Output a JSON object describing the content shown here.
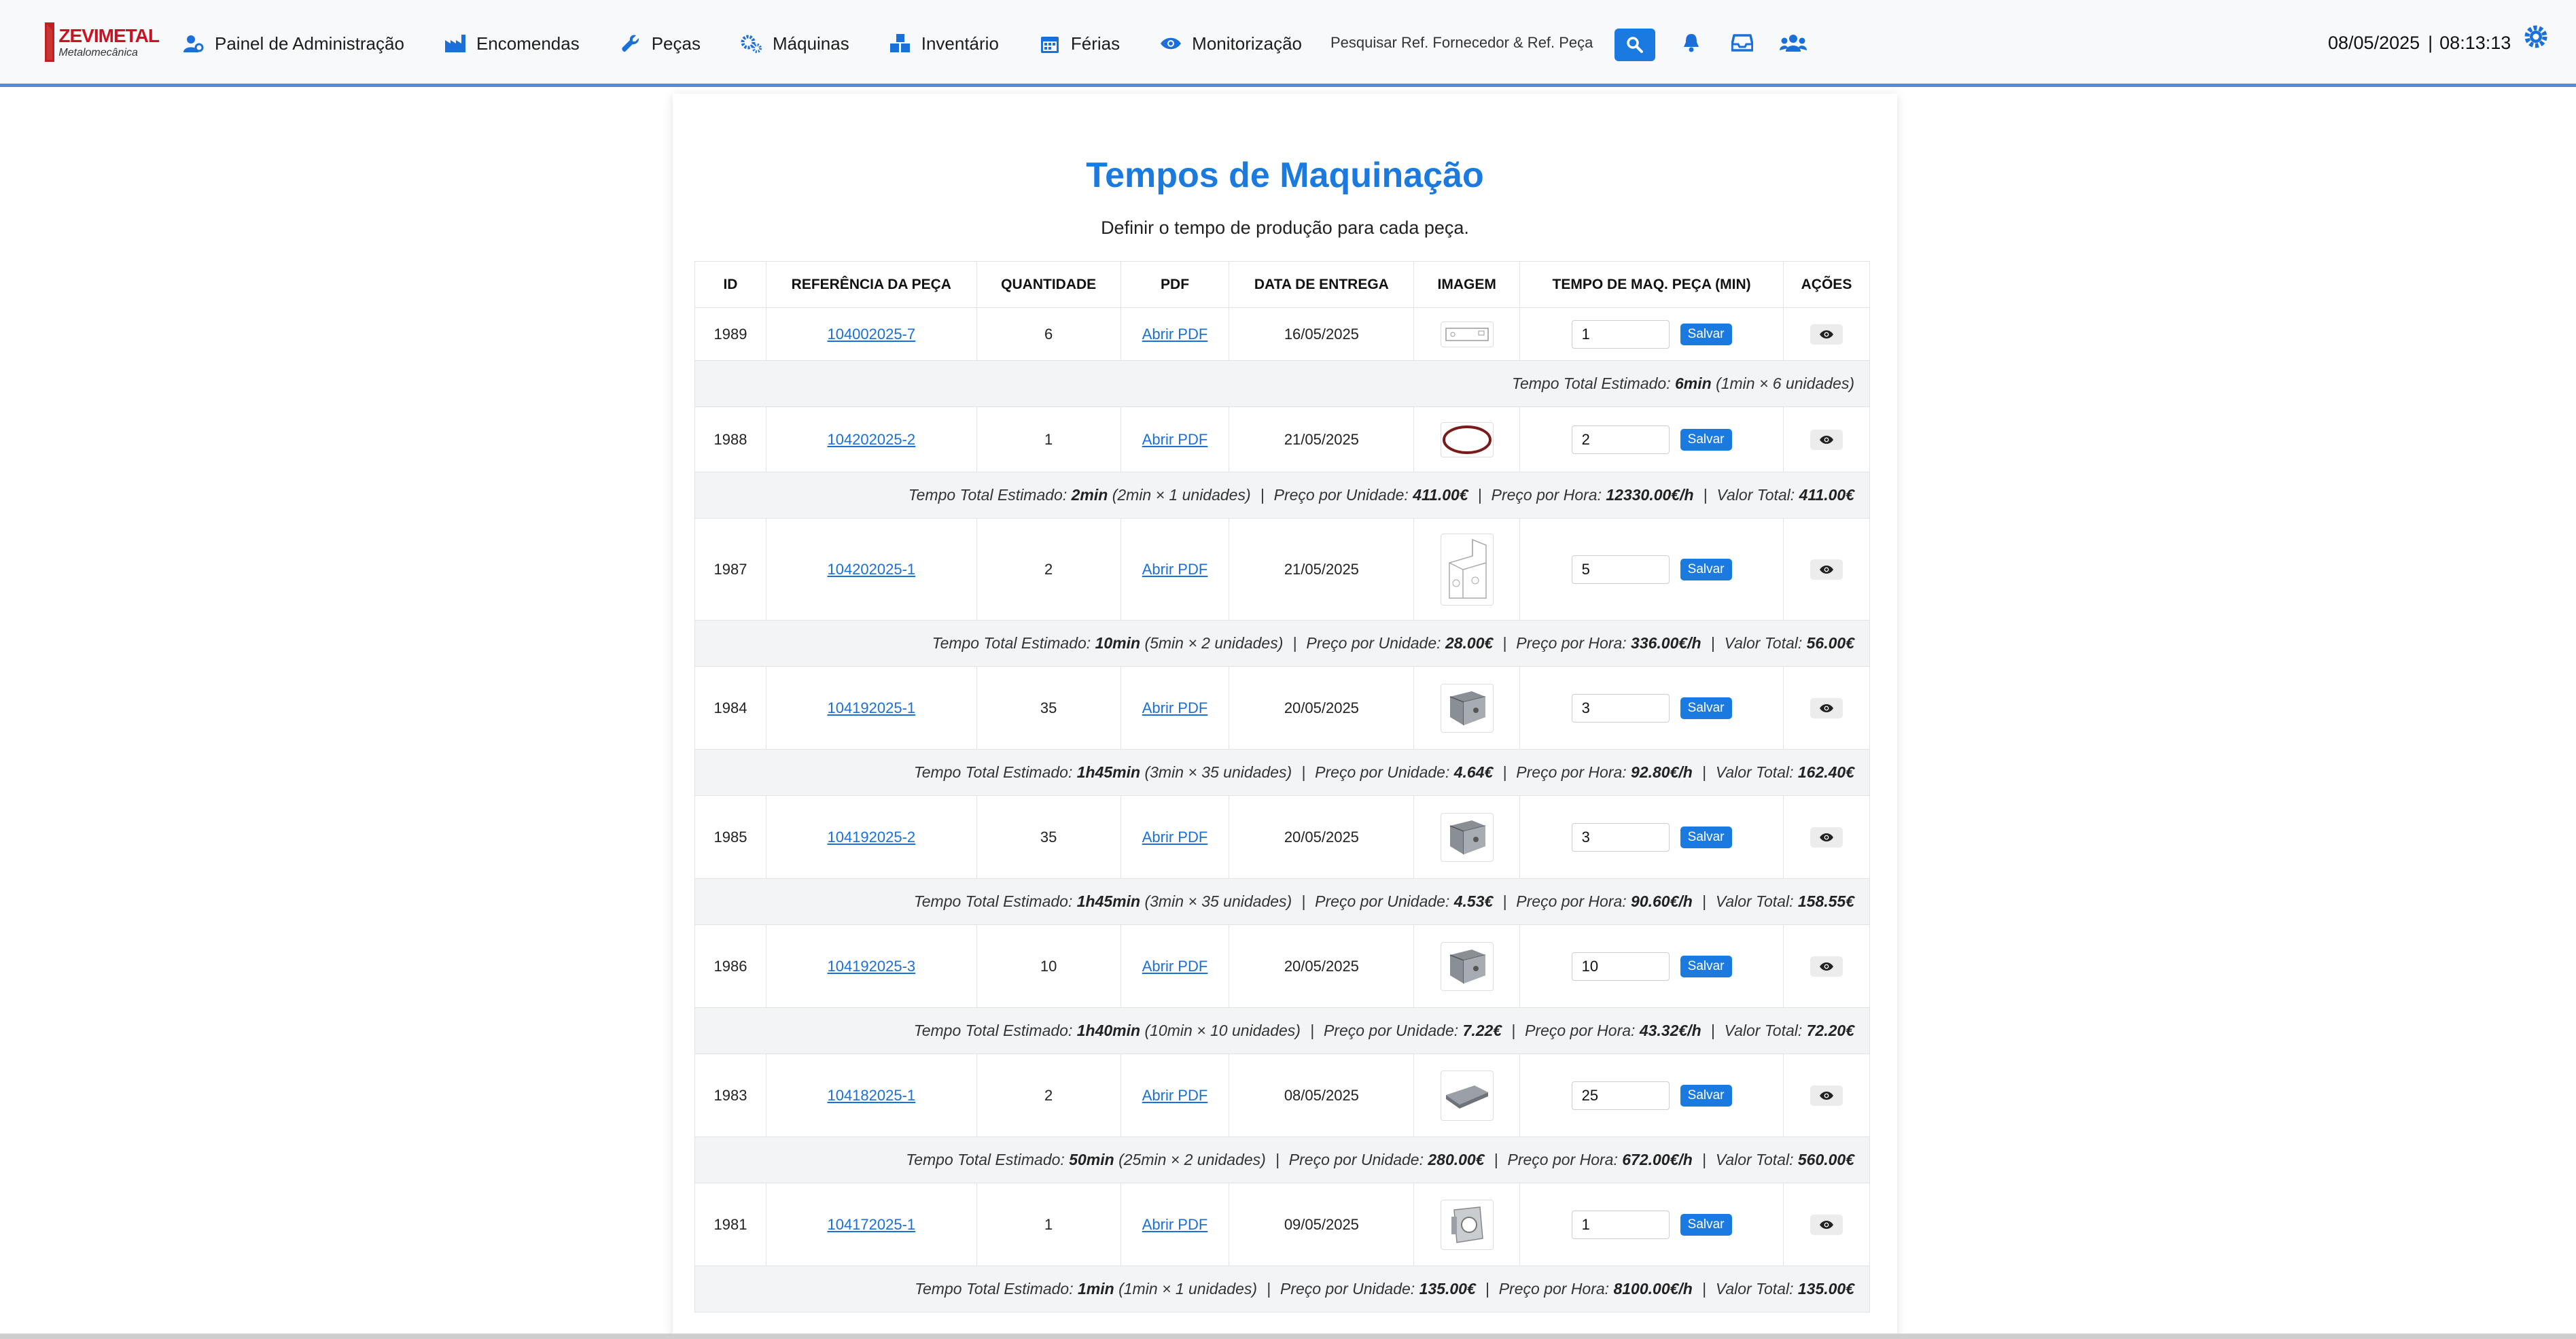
{
  "brand": {
    "name": "ZEVIMETAL",
    "tagline": "Metalomecânica"
  },
  "nav": [
    {
      "label": "Painel de Administração",
      "icon": "user-gear-icon"
    },
    {
      "label": "Encomendas",
      "icon": "industry-icon"
    },
    {
      "label": "Peças",
      "icon": "wrench-icon"
    },
    {
      "label": "Máquinas",
      "icon": "gears-icon"
    },
    {
      "label": "Inventário",
      "icon": "boxes-icon"
    },
    {
      "label": "Férias",
      "icon": "calendar-icon"
    },
    {
      "label": "Monitorização",
      "icon": "eye-icon"
    }
  ],
  "search": {
    "placeholder": "Pesquisar Ref. Fornecedor & Ref. Peça"
  },
  "datetime": {
    "date": "08/05/2025",
    "separator": "|",
    "time": "08:13:13"
  },
  "page": {
    "title": "Tempos de Maquinação",
    "subtitle": "Definir o tempo de produção para cada peça."
  },
  "table": {
    "headers": [
      "ID",
      "REFERÊNCIA DA PEÇA",
      "QUANTIDADE",
      "PDF",
      "DATA DE ENTREGA",
      "IMAGEM",
      "TEMPO DE MAQ. PEÇA (MIN)",
      "AÇÕES"
    ],
    "pdf_label": "Abrir PDF",
    "save_label": "Salvar",
    "summary_labels": {
      "total": "Tempo Total Estimado:",
      "unit_price": "Preço por Unidade:",
      "hour_price": "Preço por Hora:",
      "total_value": "Valor Total:"
    },
    "rows": [
      {
        "id": "1989",
        "ref": "104002025-7",
        "qty": "6",
        "date": "16/05/2025",
        "time": "1",
        "image": "flat-plate",
        "summary": {
          "total": "6min",
          "detail": "(1min × 6 unidades)",
          "unit_price": "",
          "hour_price": "",
          "total_value": ""
        }
      },
      {
        "id": "1988",
        "ref": "104202025-2",
        "qty": "1",
        "date": "21/05/2025",
        "time": "2",
        "image": "ring",
        "summary": {
          "total": "2min",
          "detail": "(2min × 1 unidades)",
          "unit_price": "411.00€",
          "hour_price": "12330.00€/h",
          "total_value": "411.00€"
        }
      },
      {
        "id": "1987",
        "ref": "104202025-1",
        "qty": "2",
        "date": "21/05/2025",
        "time": "5",
        "image": "bracket",
        "summary": {
          "total": "10min",
          "detail": "(5min × 2 unidades)",
          "unit_price": "28.00€",
          "hour_price": "336.00€/h",
          "total_value": "56.00€"
        }
      },
      {
        "id": "1984",
        "ref": "104192025-1",
        "qty": "35",
        "date": "20/05/2025",
        "time": "3",
        "image": "block",
        "summary": {
          "total": "1h45min",
          "detail": "(3min × 35 unidades)",
          "unit_price": "4.64€",
          "hour_price": "92.80€/h",
          "total_value": "162.40€"
        }
      },
      {
        "id": "1985",
        "ref": "104192025-2",
        "qty": "35",
        "date": "20/05/2025",
        "time": "3",
        "image": "block",
        "summary": {
          "total": "1h45min",
          "detail": "(3min × 35 unidades)",
          "unit_price": "4.53€",
          "hour_price": "90.60€/h",
          "total_value": "158.55€"
        }
      },
      {
        "id": "1986",
        "ref": "104192025-3",
        "qty": "10",
        "date": "20/05/2025",
        "time": "10",
        "image": "block",
        "summary": {
          "total": "1h40min",
          "detail": "(10min × 10 unidades)",
          "unit_price": "7.22€",
          "hour_price": "43.32€/h",
          "total_value": "72.20€"
        }
      },
      {
        "id": "1983",
        "ref": "104182025-1",
        "qty": "2",
        "date": "08/05/2025",
        "time": "25",
        "image": "plate",
        "summary": {
          "total": "50min",
          "detail": "(25min × 2 unidades)",
          "unit_price": "280.00€",
          "hour_price": "672.00€/h",
          "total_value": "560.00€"
        }
      },
      {
        "id": "1981",
        "ref": "104172025-1",
        "qty": "1",
        "date": "09/05/2025",
        "time": "1",
        "image": "flange",
        "summary": {
          "total": "1min",
          "detail": "(1min × 1 unidades)",
          "unit_price": "135.00€",
          "hour_price": "8100.00€/h",
          "total_value": "135.00€"
        }
      }
    ]
  },
  "colors": {
    "accent": "#1a7ae0",
    "nav_border": "#4a90d9",
    "summary_bg": "#f3f4f6"
  }
}
